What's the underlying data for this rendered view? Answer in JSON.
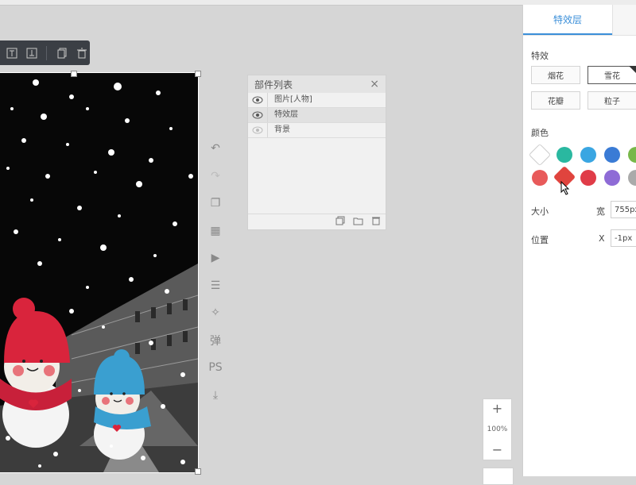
{
  "toolbar": {
    "icons": [
      "align-top-icon",
      "align-bottom-icon",
      "copy-icon",
      "delete-icon"
    ]
  },
  "vertical_tools": [
    {
      "name": "undo-icon",
      "glyph": "↶"
    },
    {
      "name": "redo-icon",
      "glyph": "↷"
    },
    {
      "name": "layers-copy-icon",
      "glyph": "❐"
    },
    {
      "name": "grid-icon",
      "glyph": "▦"
    },
    {
      "name": "play-icon",
      "glyph": "▶"
    },
    {
      "name": "table-icon",
      "glyph": "☰"
    },
    {
      "name": "magic-wand-icon",
      "glyph": "✧"
    },
    {
      "name": "popup-tool",
      "label": "弹"
    },
    {
      "name": "ps-tool",
      "label": "PS"
    },
    {
      "name": "import-icon",
      "glyph": "⤓"
    }
  ],
  "layers_panel": {
    "title": "部件列表",
    "layers": [
      {
        "label": "图片[人物]",
        "visible": true
      },
      {
        "label": "特效层",
        "visible": true,
        "selected": true
      },
      {
        "label": "背景",
        "visible": false
      }
    ]
  },
  "zoom": {
    "level": "100%",
    "plus": "+",
    "minus": "−"
  },
  "right_panel": {
    "tab": "特效层",
    "effects_label": "特效",
    "effects": [
      "烟花",
      "雪花",
      "花瓣",
      "粒子"
    ],
    "active_effect": "雪花",
    "color_label": "颜色",
    "colors": [
      "#ffffff",
      "#2ab8a0",
      "#3aa6e2",
      "#3a7bd5",
      "#78b84a",
      "#e85a5a",
      "#e0443e",
      "#e03c48",
      "#8e6bd6",
      "#aaaaaa"
    ],
    "size_label": "大小",
    "width_label": "宽",
    "width_value": "755px",
    "position_label": "位置",
    "x_label": "X",
    "x_value": "-1px"
  }
}
